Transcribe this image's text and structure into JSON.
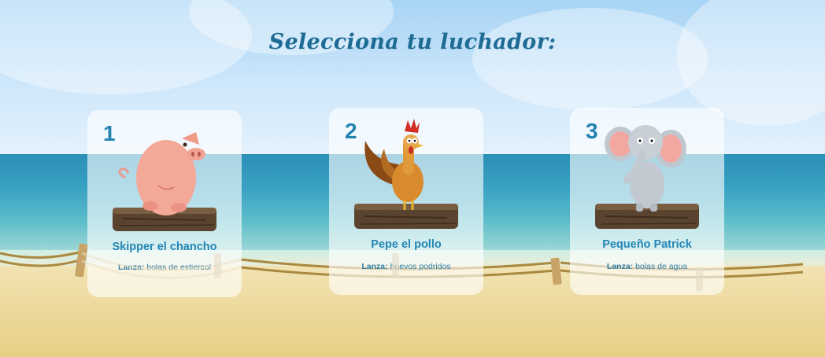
{
  "screen": {
    "title": "Selecciona tu luchador:"
  },
  "fighters": [
    {
      "number": "1",
      "name": "Skipper el chancho",
      "attack_label": "Lanza:",
      "attack_value": "bolas de estiercol",
      "animal": "pig-icon"
    },
    {
      "number": "2",
      "name": "Pepe el pollo",
      "attack_label": "Lanza:",
      "attack_value": "huevos podridos",
      "animal": "rooster-icon"
    },
    {
      "number": "3",
      "name": "Pequeño Patrick",
      "attack_label": "Lanza:",
      "attack_value": "bolas de agua",
      "animal": "elephant-icon"
    }
  ],
  "colors": {
    "title": "#1e6b93",
    "accent": "#2286b6",
    "card_bg": "rgba(255,255,255,0.62)"
  }
}
